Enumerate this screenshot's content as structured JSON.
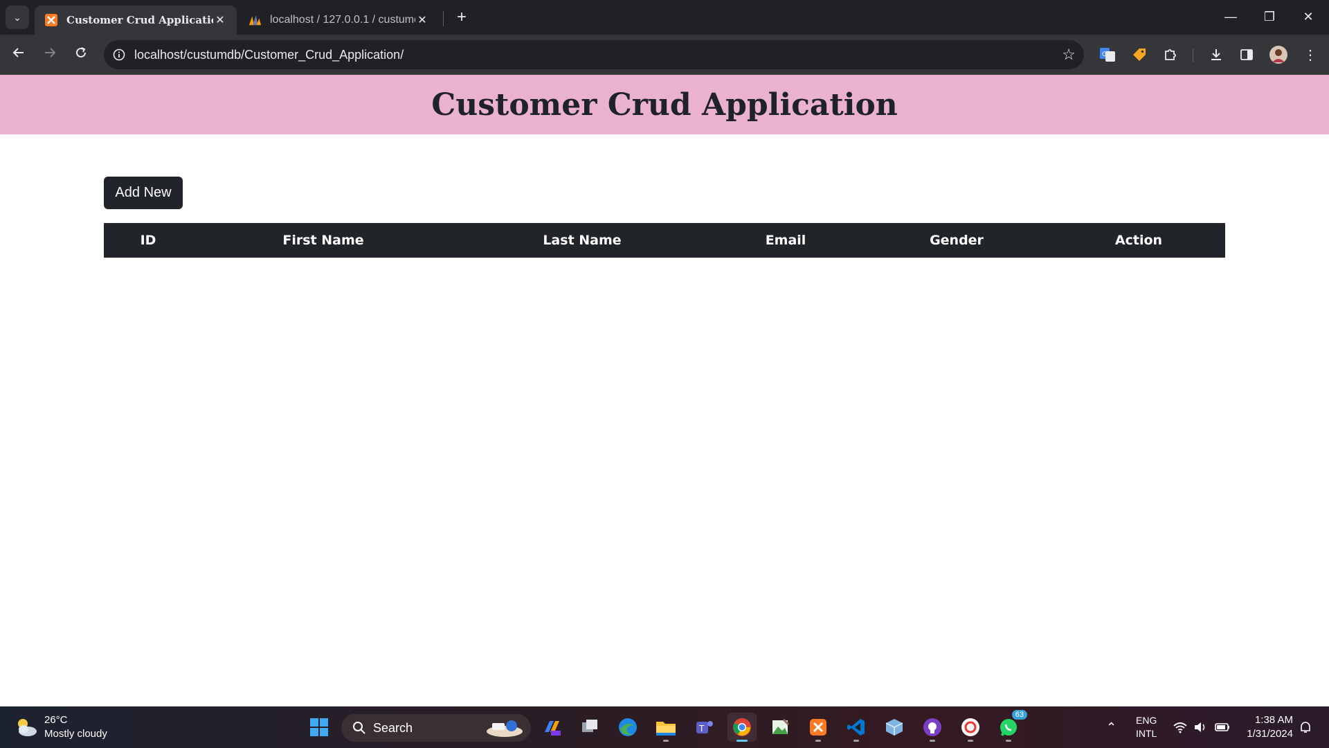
{
  "browser": {
    "tabs": [
      {
        "title": "Customer Crud Application",
        "active": true,
        "favicon": "xampp-icon"
      },
      {
        "title": "localhost / 127.0.0.1 / custumdb",
        "active": false,
        "favicon": "phpmyadmin-icon"
      }
    ],
    "url": "localhost/custumdb/Customer_Crud_Application/"
  },
  "app": {
    "title": "Customer Crud Application",
    "add_button_label": "Add New",
    "table": {
      "columns": [
        "ID",
        "First Name",
        "Last Name",
        "Email",
        "Gender",
        "Action"
      ],
      "rows": []
    },
    "header_color": "#ebb2d0",
    "accent_dark": "#212529"
  },
  "taskbar": {
    "weather": {
      "temp": "26°C",
      "condition": "Mostly cloudy"
    },
    "search_placeholder": "Search",
    "whatsapp_badge": "63",
    "language": {
      "line1": "ENG",
      "line2": "INTL"
    },
    "time": "1:38 AM",
    "date": "1/31/2024"
  }
}
